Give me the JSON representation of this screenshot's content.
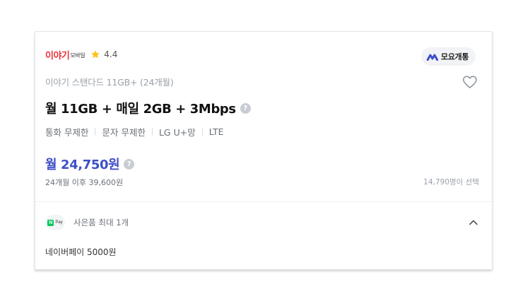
{
  "brand": {
    "logo_main": "이야기",
    "logo_sub": "모바일",
    "rating": "4.4",
    "logo_color": "#e8313a"
  },
  "badge": {
    "label": "모요개통",
    "icon": "moyo-logo-icon",
    "accent": "#3d4fc8"
  },
  "plan": {
    "subtitle": "이야기 스탠다드 11GB+ (24개월)",
    "title": "월 11GB + 매일 2GB + 3Mbps",
    "features": [
      "통화 무제한",
      "문자 무제한",
      "LG U+망",
      "LTE"
    ]
  },
  "price": {
    "monthly": "월 24,750원",
    "after": "24개월 이후 39,600원",
    "selected_count": "14,790명이 선택",
    "color": "#3d4fc8"
  },
  "gift": {
    "pay_icon_text": "Pay",
    "label": "사은품 최대 1개",
    "item": "네이버페이 5000원"
  }
}
